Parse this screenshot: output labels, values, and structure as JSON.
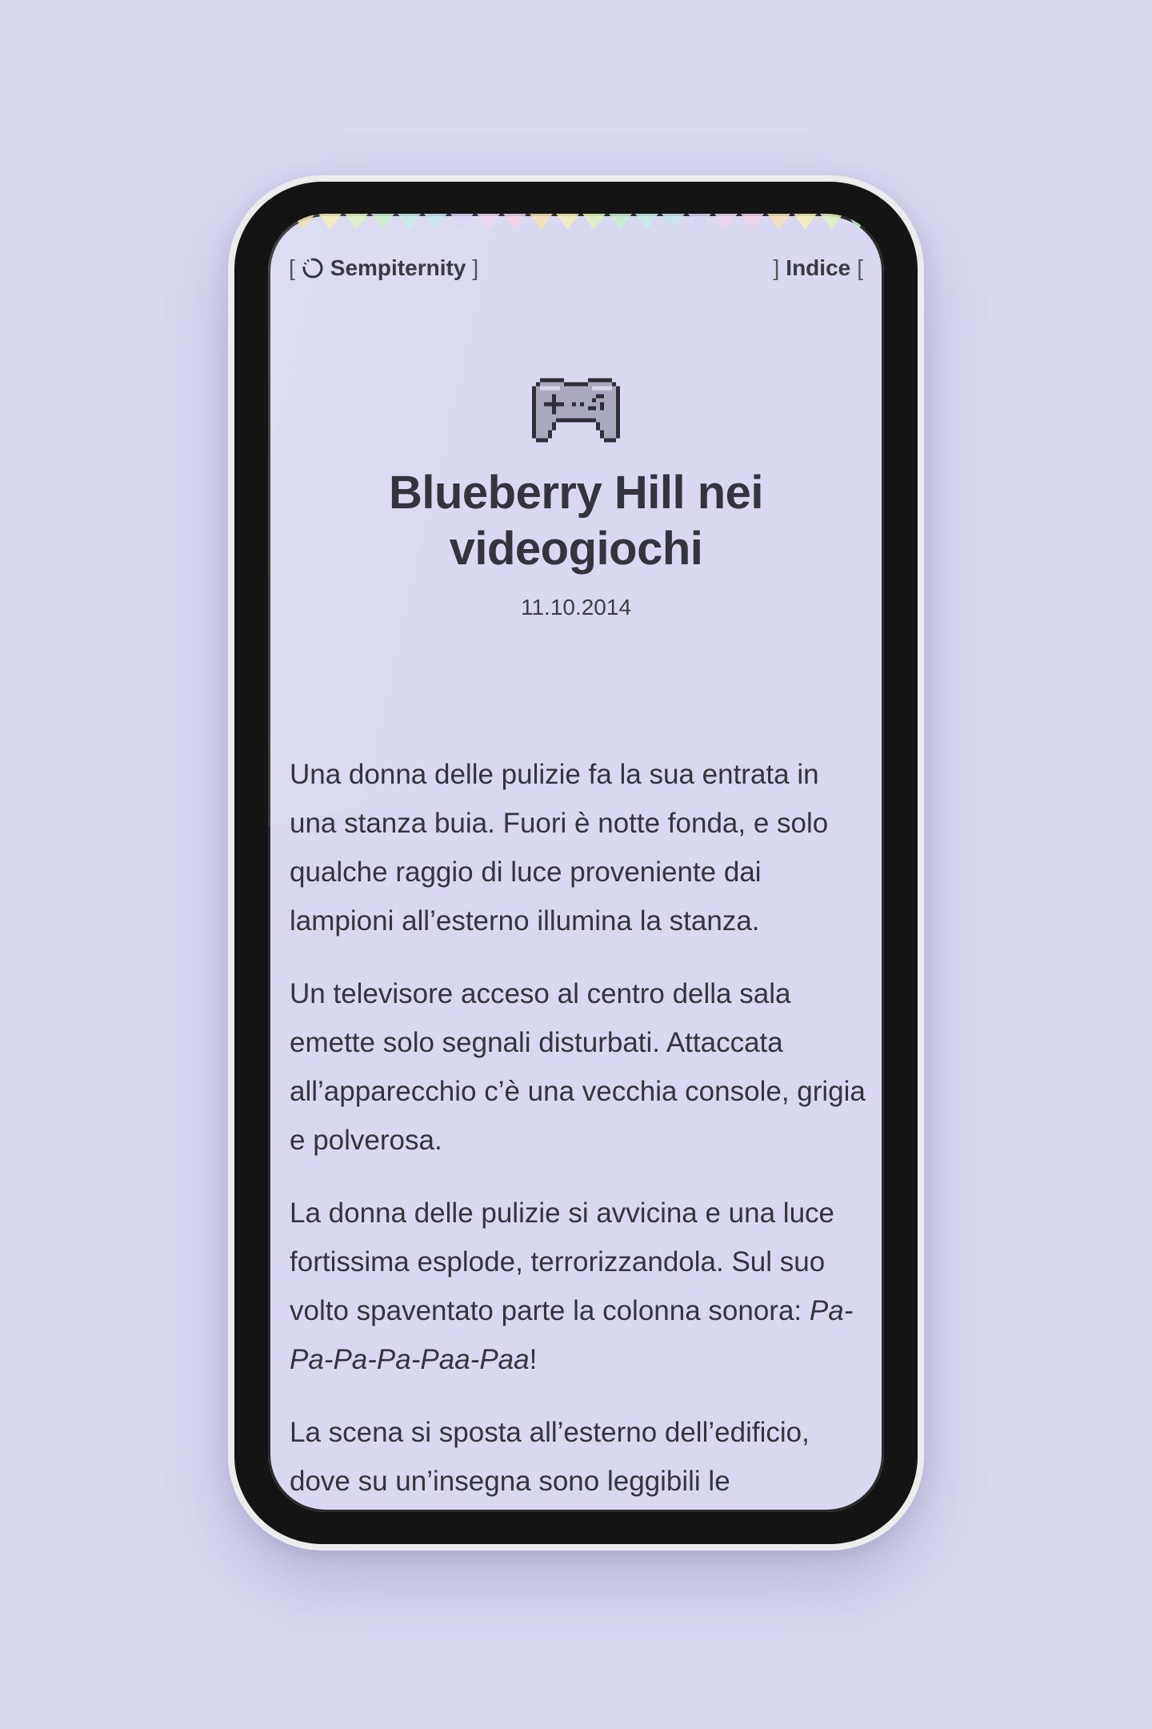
{
  "header": {
    "brand_open": "[",
    "brand_name": "Sempiternity",
    "brand_close": "]",
    "nav_open": "]",
    "nav_label": "Indice",
    "nav_close": "["
  },
  "post": {
    "icon": "gamepad-icon",
    "title": "Blueberry Hill nei videogiochi",
    "date": "11.10.2014",
    "paragraphs": [
      "Una donna delle pulizie fa la sua entrata in una stanza buia. Fuori è notte fonda, e solo qualche raggio di luce proveniente dai lampioni all’esterno illumina la stanza.",
      "Un televisore acceso al centro della sala emette solo segnali disturbati. Attaccata all’apparecchio c’è una vecchia console, grigia e polverosa."
    ],
    "paragraph3_text": "La donna delle pulizie si avvicina e una luce fortissima esplode, terrorizzandola. Sul suo volto spaventato parte la colonna sonora: ",
    "paragraph3_italic": "Pa-Pa-Pa-Pa-Paa-Paa",
    "paragraph3_end": "!",
    "paragraph4_text": "La scena si sposta all’esterno dell’edificio, dove su un’insegna sono leggibili le"
  },
  "colors": {
    "background": "#d8d8f0",
    "text": "#34343c",
    "bezel": "#141414"
  }
}
